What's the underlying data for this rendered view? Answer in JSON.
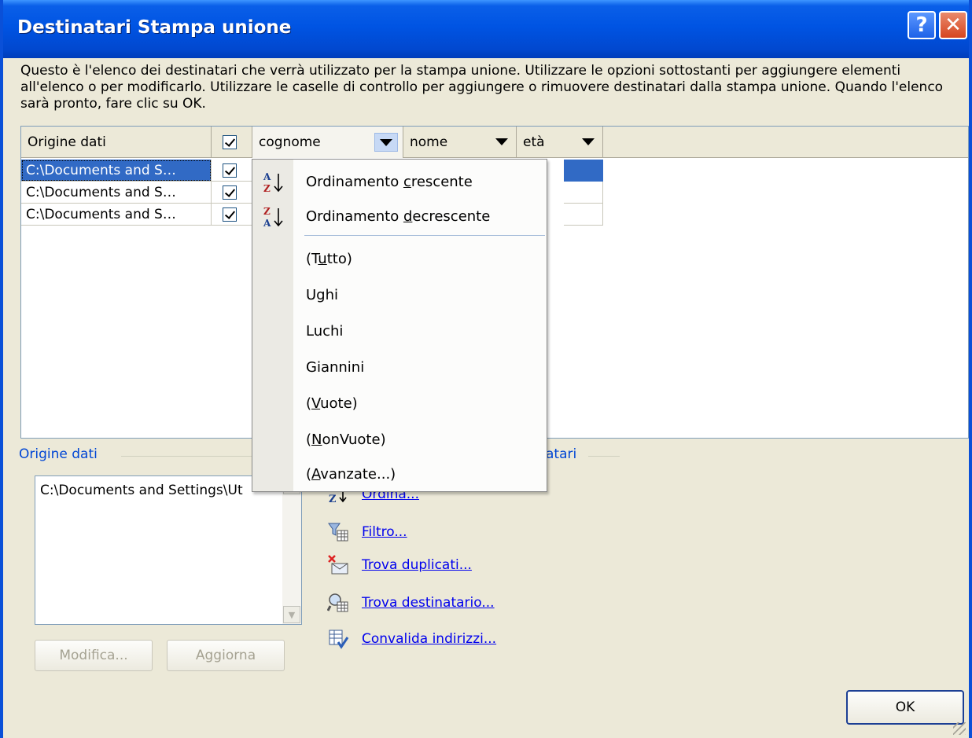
{
  "window": {
    "title": "Destinatari Stampa unione",
    "help_glyph": "?",
    "close_glyph": "✕"
  },
  "intro_text": "Questo è l'elenco dei destinatari che verrà utilizzato per la stampa unione. Utilizzare le opzioni sottostanti per aggiungere elementi all'elenco o per modificarlo. Utilizzare le caselle di controllo per aggiungere o rimuovere destinatari dalla stampa unione. Quando l'elenco sarà pronto, fare clic su OK.",
  "grid": {
    "columns": [
      "Origine dati",
      "cognome",
      "nome",
      "età"
    ],
    "rows": [
      {
        "source": "C:\\Documents and S…",
        "checked": true
      },
      {
        "source": "C:\\Documents and S…",
        "checked": true
      },
      {
        "source": "C:\\Documents and S…",
        "checked": true
      }
    ]
  },
  "dropdown_menu": {
    "sort_asc": {
      "pre": "Ordinamento ",
      "key": "c",
      "post": "rescente"
    },
    "sort_desc": {
      "pre": "Ordinamento ",
      "key": "d",
      "post": "ecrescente"
    },
    "filters": [
      {
        "pre": "(T",
        "key": "u",
        "post": "tto)"
      },
      {
        "pre": "Ughi",
        "key": "",
        "post": ""
      },
      {
        "pre": "Luchi",
        "key": "",
        "post": ""
      },
      {
        "pre": "Giannini",
        "key": "",
        "post": ""
      },
      {
        "pre": "(",
        "key": "V",
        "post": "uote)"
      },
      {
        "pre": "(",
        "key": "N",
        "post": "onVuote)"
      },
      {
        "pre": "(",
        "key": "A",
        "post": "vanzate...)"
      }
    ]
  },
  "source_group": {
    "label": "Origine dati",
    "list_item": "C:\\Documents and Settings\\Ut",
    "edit_button": "Modifica...",
    "refresh_button": "Aggiorna"
  },
  "refine_group": {
    "label_visible": "atari",
    "links": [
      {
        "label": "Ordina..."
      },
      {
        "label": "Filtro..."
      },
      {
        "label": "Trova duplicati..."
      },
      {
        "label": "Trova destinatario..."
      },
      {
        "label": "Convalida indirizzi..."
      }
    ]
  },
  "ok_button": "OK",
  "colors": {
    "title_bar": "#0054e3",
    "selection": "#316ac5",
    "link": "#0000ee",
    "dialog_bg": "#ece9d8"
  }
}
